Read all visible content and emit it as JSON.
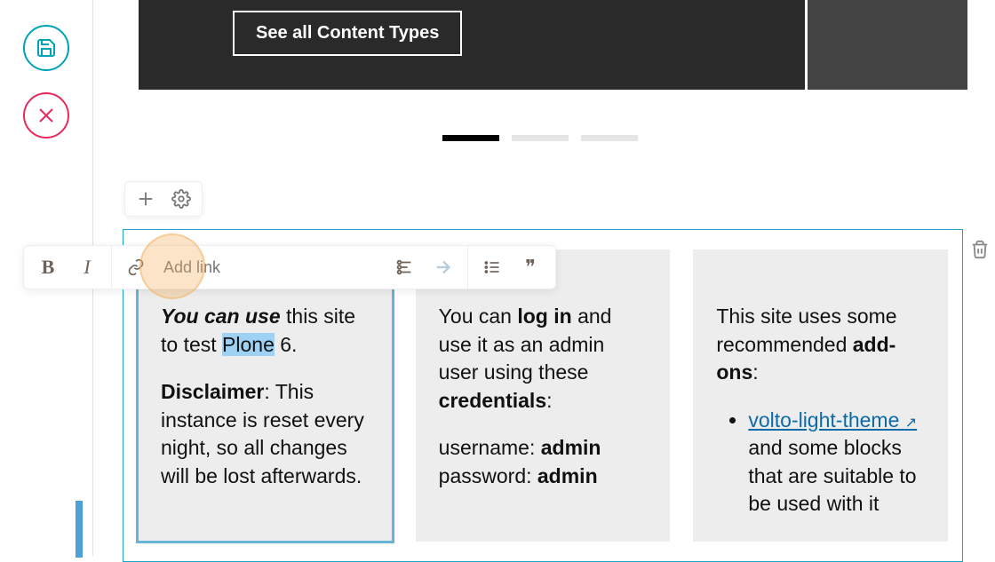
{
  "hero": {
    "button_label": "See all Content Types"
  },
  "toolbar": {
    "link_placeholder": "Add link"
  },
  "columns": {
    "col1": {
      "p1_prefix_bold_italic": "You can use",
      "p1_mid": " this site to test ",
      "p1_highlight": "Plone",
      "p1_suffix": " 6.",
      "p2_strong": "Disclaimer",
      "p2_rest": ": This instance is reset every night, so all changes will be lost afterwards."
    },
    "col2": {
      "p1_a": "You can ",
      "p1_b_bold": "log in",
      "p1_c": " and use it as an admin user using these ",
      "p1_d_bold": "credentials",
      "p1_e": ":",
      "user_label": "username: ",
      "user_val": "admin",
      "pass_label": "password: ",
      "pass_val": "admin"
    },
    "col3": {
      "p1_a": "This site uses some recommended ",
      "p1_b_bold": "add-ons",
      "p1_c": ":",
      "li1_link": "volto-light-theme ",
      "li1_rest": " and some blocks that are suitable to be used with it"
    }
  }
}
